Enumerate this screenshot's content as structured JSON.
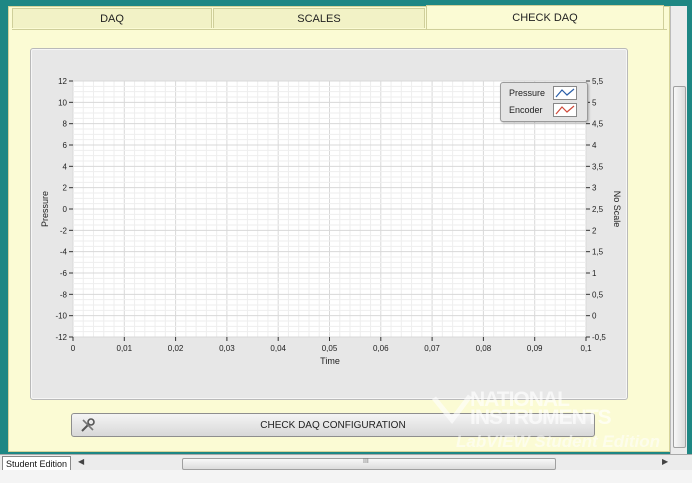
{
  "tabs": [
    {
      "label": "DAQ",
      "active": false
    },
    {
      "label": "SCALES",
      "active": false
    },
    {
      "label": "CHECK DAQ",
      "active": true
    }
  ],
  "legend": [
    {
      "label": "Pressure",
      "color": "#2a5ea8"
    },
    {
      "label": "Encoder",
      "color": "#d04a3a"
    }
  ],
  "button": {
    "label": "CHECK DAQ CONFIGURATION",
    "icon": "tools-icon"
  },
  "status": {
    "edition": "Student Edition"
  },
  "scroll": {
    "thumb_grip": "III"
  },
  "watermark": {
    "line1": "NATIONAL",
    "line2": "INSTRUMENTS",
    "line3": "LabVIEW Student Edition"
  },
  "chart_data": {
    "type": "line",
    "xlabel": "Time",
    "ylabel": "Pressure",
    "y2label": "No Scale",
    "xlim": [
      0,
      0.1
    ],
    "ylim": [
      -12,
      12
    ],
    "y2lim": [
      -0.5,
      5.5
    ],
    "x_ticks": [
      "0",
      "0,01",
      "0,02",
      "0,03",
      "0,04",
      "0,05",
      "0,06",
      "0,07",
      "0,08",
      "0,09",
      "0,1"
    ],
    "y_ticks": [
      "12",
      "10",
      "8",
      "6",
      "4",
      "2",
      "0",
      "-2",
      "-4",
      "-6",
      "-8",
      "-10",
      "-12"
    ],
    "y2_ticks": [
      "5,5",
      "5",
      "4,5",
      "4",
      "3,5",
      "3",
      "2,5",
      "2",
      "1,5",
      "1",
      "0,5",
      "0",
      "-0,5"
    ],
    "grid": true,
    "legend_position": "top-right",
    "series": [
      {
        "name": "Pressure",
        "values": []
      },
      {
        "name": "Encoder",
        "values": []
      }
    ]
  }
}
